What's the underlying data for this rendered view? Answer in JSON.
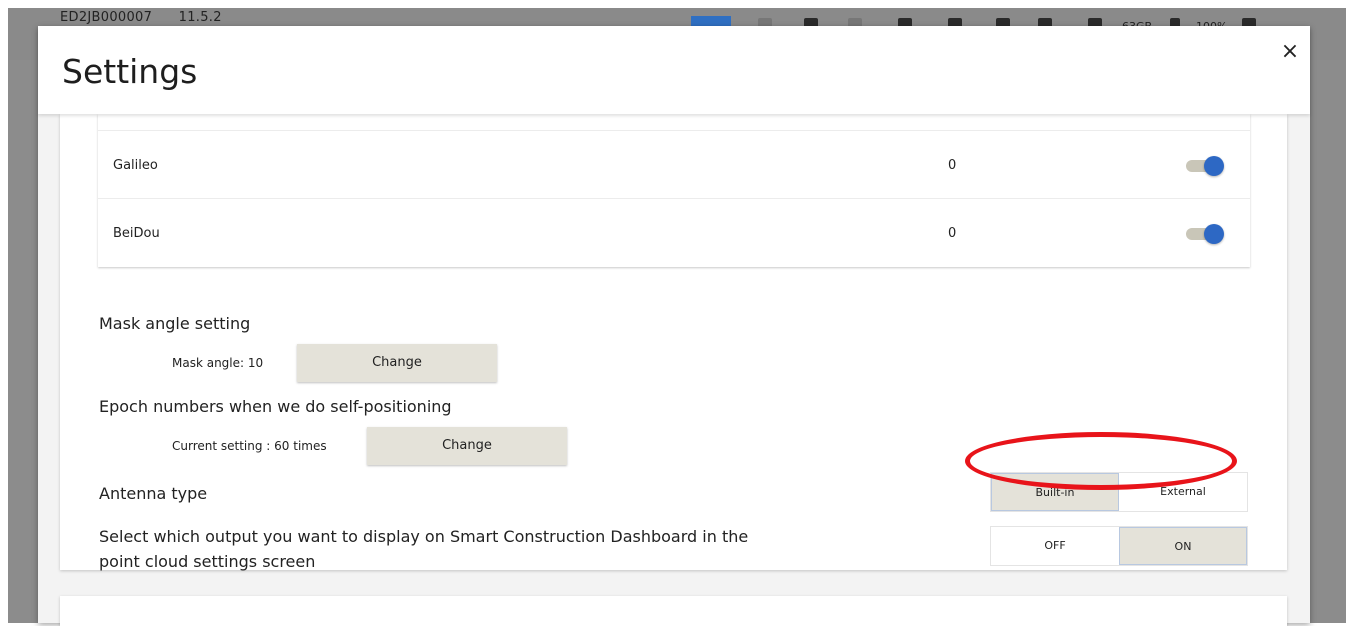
{
  "appbar": {
    "device_id": "ED2JB000007",
    "version": "11.5.2",
    "storage": "63GB",
    "battery": "100%"
  },
  "dialog": {
    "title": "Settings",
    "close_glyph": "×"
  },
  "gnss": {
    "rows": [
      {
        "name": "Galileo",
        "count": "0",
        "enabled": true
      },
      {
        "name": "BeiDou",
        "count": "0",
        "enabled": true
      }
    ]
  },
  "mask": {
    "heading": "Mask angle setting",
    "current": "Mask angle: 10",
    "button": "Change"
  },
  "epoch": {
    "heading": "Epoch numbers when we do self-positioning",
    "current": "Current setting : 60 times",
    "button": "Change"
  },
  "antenna": {
    "heading": "Antenna type",
    "options": [
      "Built-in",
      "External"
    ],
    "selected": "Built-in"
  },
  "output": {
    "heading_line1": "Select which output you want to display on Smart Construction Dashboard in the",
    "heading_line2": "point cloud settings screen",
    "options": [
      "OFF",
      "ON"
    ],
    "selected": "ON"
  },
  "colors": {
    "accent": "#2d68c4",
    "button_bg": "#e4e2d9",
    "annotation": "#e8141a"
  },
  "icons": [
    "refresh-icon",
    "usb-icon",
    "cloud-icon",
    "signal-icon",
    "satellite-icon",
    "folder-icon",
    "battery-icon",
    "gear-icon",
    "back-arrow-icon",
    "close-icon"
  ]
}
